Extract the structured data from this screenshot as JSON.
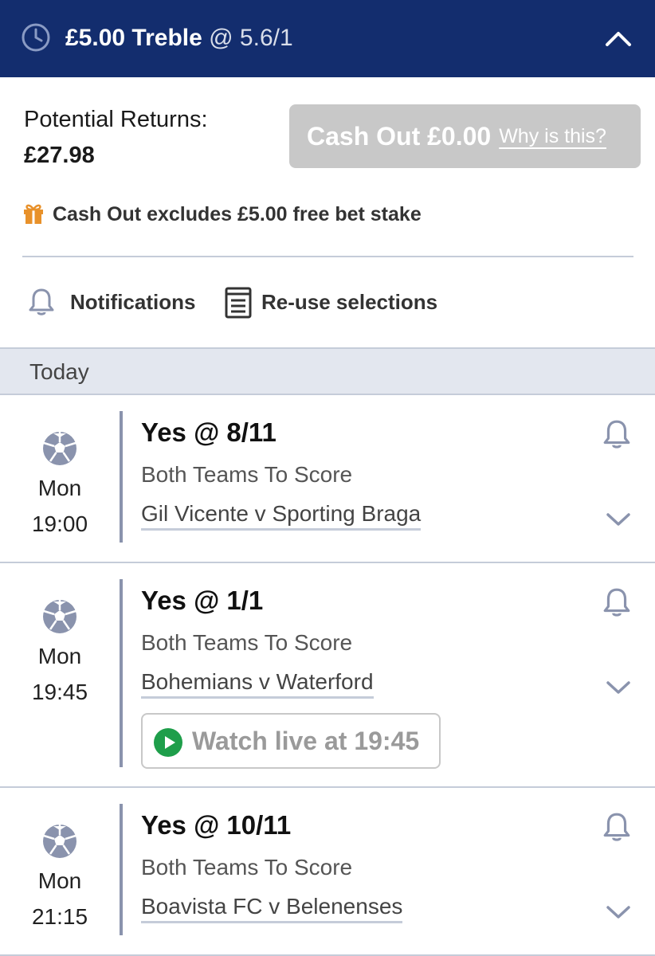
{
  "header": {
    "stake_label": "£5.00 Treble",
    "odds_label": "@ 5.6/1",
    "clock_icon": "clock-icon",
    "collapse_icon": "chevron-up-icon",
    "background": "#132d6e"
  },
  "returns": {
    "label": "Potential Returns:",
    "value": "£27.98"
  },
  "cashout": {
    "label": "Cash Out £0.00",
    "why_label": "Why is this?",
    "background": "#c8c8c8"
  },
  "free_bet_note": {
    "icon": "gift-icon",
    "text": "Cash Out excludes £5.00 free bet stake",
    "icon_color": "#e8912a"
  },
  "actions": {
    "notifications_label": "Notifications",
    "reuse_label": "Re-use selections"
  },
  "section": {
    "label": "Today"
  },
  "selections": [
    {
      "pick": "Yes @ 8/11",
      "market": "Both Teams To Score",
      "event": "Gil Vicente v Sporting Braga",
      "day": "Mon",
      "time": "19:00"
    },
    {
      "pick": "Yes @ 1/1",
      "market": "Both Teams To Score",
      "event": "Bohemians v Waterford",
      "day": "Mon",
      "time": "19:45",
      "watch_label": "Watch live at 19:45",
      "watch_icon_color": "#1e9e4a"
    },
    {
      "pick": "Yes @ 10/11",
      "market": "Both Teams To Score",
      "event": "Boavista FC v Belenenses",
      "day": "Mon",
      "time": "21:15"
    }
  ]
}
